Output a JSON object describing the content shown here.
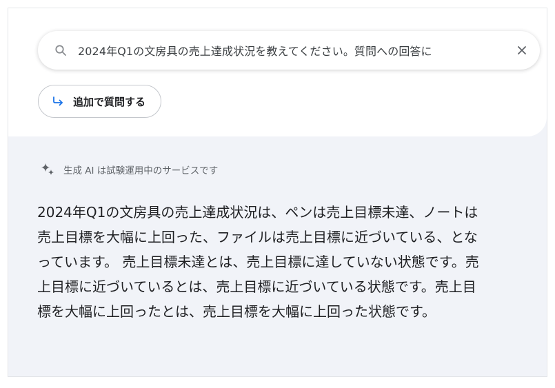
{
  "search": {
    "query": "2024年Q1の文房具の売上達成状況を教えてください。質問への回答に",
    "icon": "search-icon",
    "clear_icon": "close-icon"
  },
  "followup": {
    "label": "追加で質問する",
    "icon": "reply-arrow-icon",
    "accent_color": "#1a73e8"
  },
  "disclaimer": {
    "text": "生成 AI は試験運用中のサービスです",
    "icon": "sparkle-icon"
  },
  "answer": {
    "text": "2024年Q1の文房具の売上達成状況は、ペンは売上目標未達、ノートは売上目標を大幅に上回った、ファイルは売上目標に近づいている、となっています。 売上目標未達とは、売上目標に達していない状態です。売上目標に近づいているとは、売上目標に近づいている状態です。売上目標を大幅に上回ったとは、売上目標を大幅に上回った状態です。"
  },
  "colors": {
    "background_bottom": "#f1f3f8",
    "text_primary": "#202124",
    "text_secondary": "#5f6368"
  }
}
